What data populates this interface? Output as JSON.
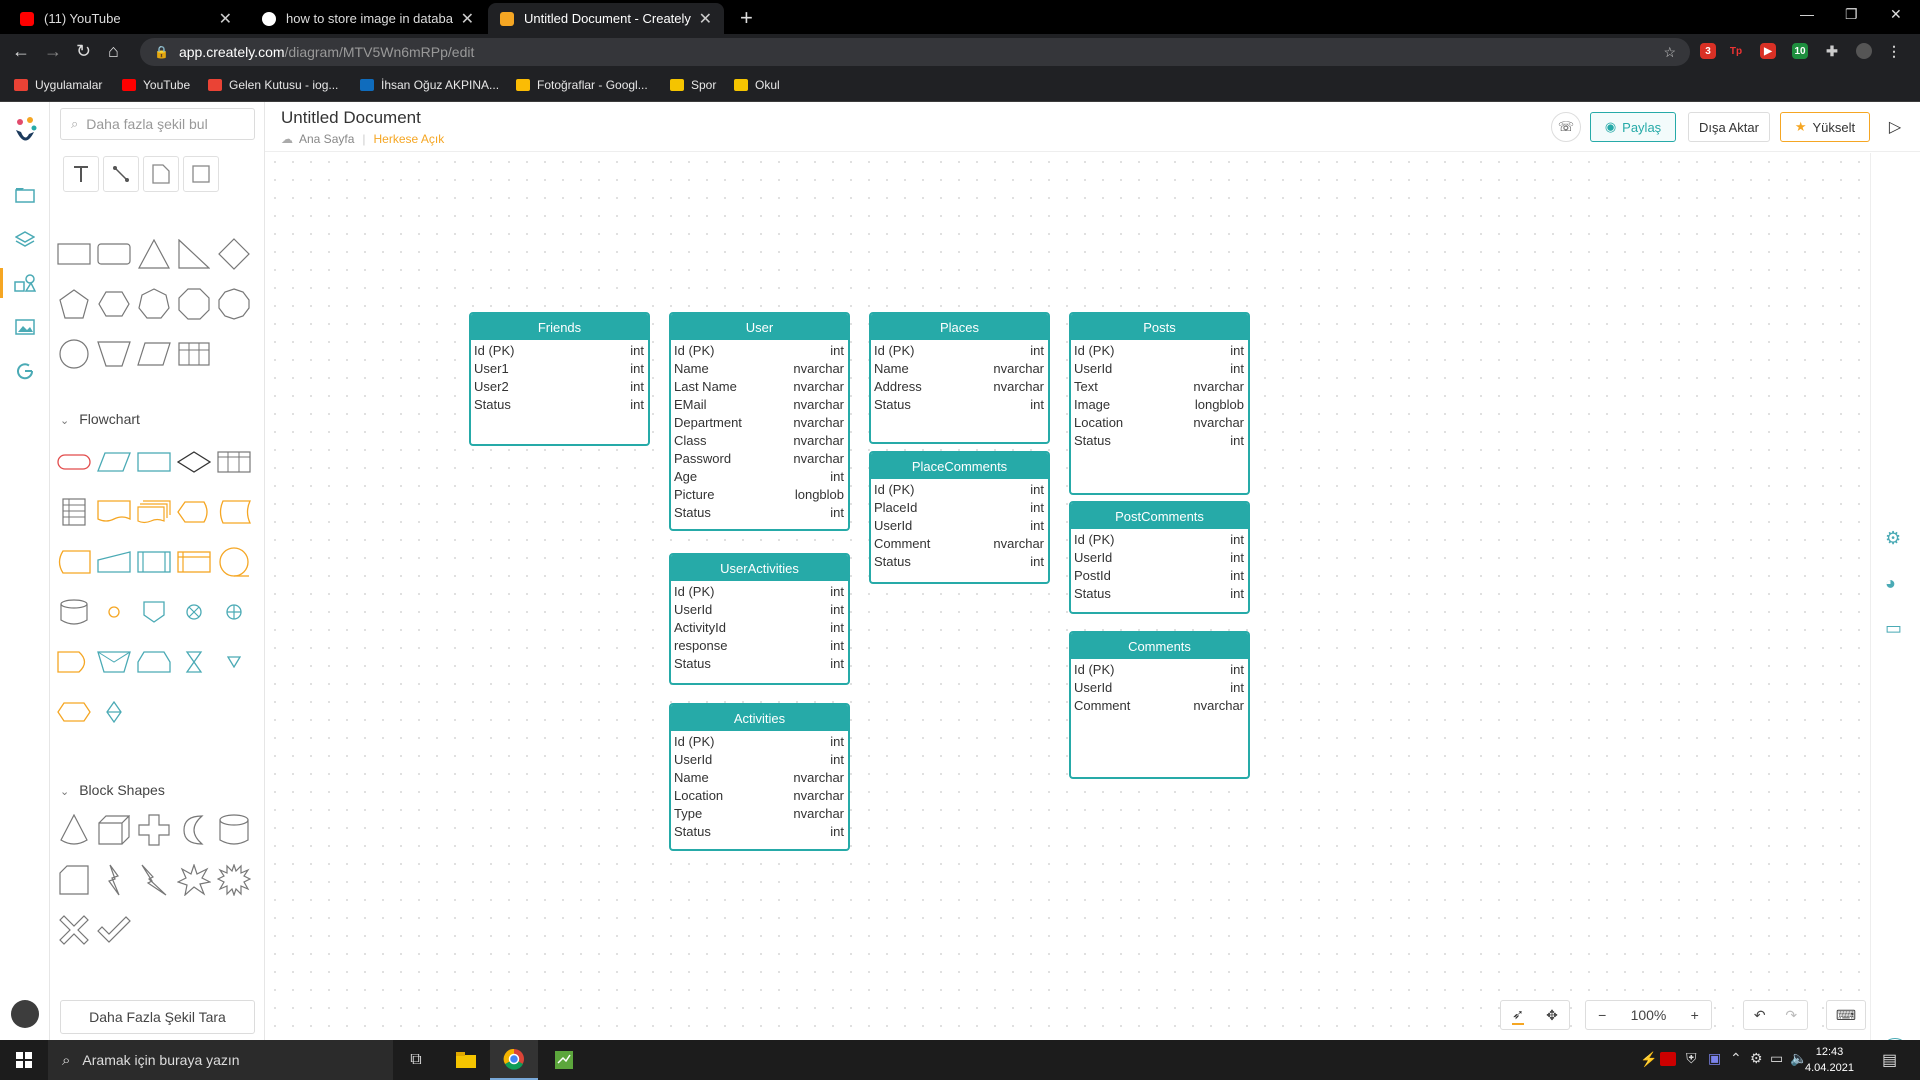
{
  "browser": {
    "tabs": [
      {
        "title": "(11) YouTube",
        "color": "#ff0000"
      },
      {
        "title": "how to store image in database -",
        "color": "#4285f4"
      },
      {
        "title": "Untitled Document - Creately",
        "color": "#f5a623"
      }
    ],
    "url_host": "app.creately.com",
    "url_path": "/diagram/MTV5Wn6mRPp/edit",
    "bookmarks": [
      {
        "label": "Uygulamalar",
        "color": "#e94235"
      },
      {
        "label": "YouTube",
        "color": "#ff0000"
      },
      {
        "label": "Gelen Kutusu - iog...",
        "color": "#ea4335"
      },
      {
        "label": "İhsan Oğuz AKPINA...",
        "color": "#0f6cbd"
      },
      {
        "label": "Fotoğraflar - Googl...",
        "color": "#fbbc04"
      },
      {
        "label": "Spor",
        "color": "#f5c400"
      },
      {
        "label": "Okul",
        "color": "#f5c400"
      }
    ],
    "extension_badges": [
      "3",
      "Tp",
      "10"
    ]
  },
  "library": {
    "search_placeholder": "Daha fazla şekil bul",
    "sections": {
      "flowchart": "Flowchart",
      "block": "Block Shapes"
    },
    "more_shapes_button": "Daha Fazla Şekil Tara"
  },
  "header": {
    "title": "Untitled Document",
    "breadcrumb_home": "Ana Sayfa",
    "visibility": "Herkese Açık",
    "share_label": "Paylaş",
    "export_label": "Dışa Aktar",
    "upgrade_label": "Yükselt"
  },
  "entities": {
    "friends": {
      "title": "Friends",
      "rows": [
        [
          "Id (PK)",
          "int"
        ],
        [
          "User1",
          "int"
        ],
        [
          "User2",
          "int"
        ],
        [
          "Status",
          "int"
        ]
      ]
    },
    "user": {
      "title": "User",
      "rows": [
        [
          "Id (PK)",
          "int"
        ],
        [
          "Name",
          "nvarchar"
        ],
        [
          "Last Name",
          "nvarchar"
        ],
        [
          "EMail",
          "nvarchar"
        ],
        [
          "Department",
          "nvarchar"
        ],
        [
          "Class",
          "nvarchar"
        ],
        [
          "Password",
          "nvarchar"
        ],
        [
          "Age",
          "int"
        ],
        [
          "Picture",
          "longblob"
        ],
        [
          "Status",
          "int"
        ]
      ]
    },
    "places": {
      "title": "Places",
      "rows": [
        [
          "Id (PK)",
          "int"
        ],
        [
          "Name",
          "nvarchar"
        ],
        [
          "Address",
          "nvarchar"
        ],
        [
          "Status",
          "int"
        ]
      ]
    },
    "posts": {
      "title": "Posts",
      "rows": [
        [
          "Id (PK)",
          "int"
        ],
        [
          "UserId",
          "int"
        ],
        [
          "Text",
          "nvarchar"
        ],
        [
          "Image",
          "longblob"
        ],
        [
          "Location",
          "nvarchar"
        ],
        [
          "Status",
          "int"
        ]
      ]
    },
    "placecomments": {
      "title": "PlaceComments",
      "rows": [
        [
          "Id (PK)",
          "int"
        ],
        [
          "PlaceId",
          "int"
        ],
        [
          "UserId",
          "int"
        ],
        [
          "Comment",
          "nvarchar"
        ],
        [
          "Status",
          "int"
        ]
      ]
    },
    "postcomments": {
      "title": "PostComments",
      "rows": [
        [
          "Id (PK)",
          "int"
        ],
        [
          "UserId",
          "int"
        ],
        [
          "PostId",
          "int"
        ],
        [
          "Status",
          "int"
        ]
      ]
    },
    "useractivities": {
      "title": "UserActivities",
      "rows": [
        [
          "Id (PK)",
          "int"
        ],
        [
          "UserId",
          "int"
        ],
        [
          "ActivityId",
          "int"
        ],
        [
          "response",
          "int"
        ],
        [
          "Status",
          "int"
        ]
      ]
    },
    "comments": {
      "title": "Comments",
      "rows": [
        [
          "Id (PK)",
          "int"
        ],
        [
          "UserId",
          "int"
        ],
        [
          "Comment",
          "nvarchar"
        ]
      ]
    },
    "activities": {
      "title": "Activities",
      "rows": [
        [
          "Id (PK)",
          "int"
        ],
        [
          "UserId",
          "int"
        ],
        [
          "Name",
          "nvarchar"
        ],
        [
          "Location",
          "nvarchar"
        ],
        [
          "Type",
          "nvarchar"
        ],
        [
          "Status",
          "int"
        ]
      ]
    }
  },
  "controls": {
    "zoom": "100%"
  },
  "taskbar": {
    "search_placeholder": "Aramak için buraya yazın",
    "time": "12:43",
    "date": "4.04.2021"
  },
  "theme": {
    "accent": "#26aaa8",
    "orange": "#f5a623"
  }
}
